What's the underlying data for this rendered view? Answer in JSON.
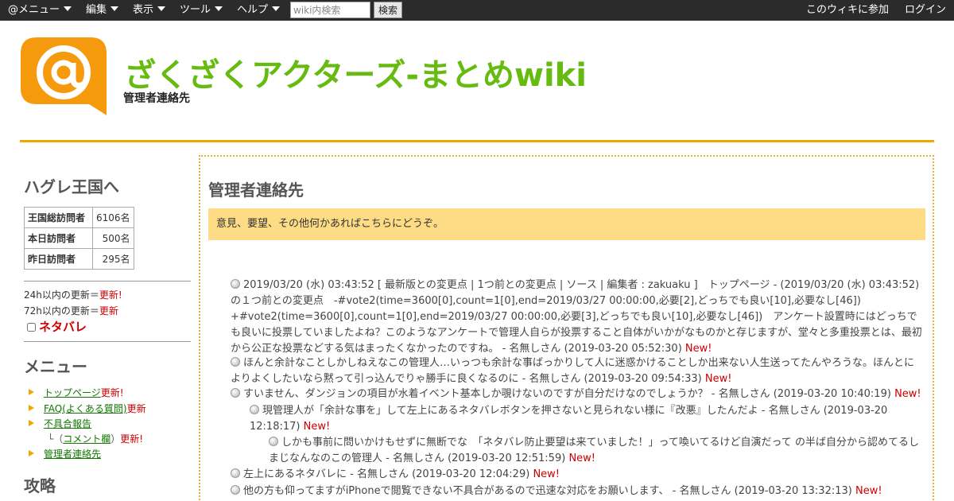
{
  "topbar": {
    "menu": "@メニュー",
    "edit": "編集",
    "view": "表示",
    "tools": "ツール",
    "help": "ヘルプ",
    "search_placeholder": "wiki内検索",
    "search_button": "検索",
    "join": "このウィキに参加",
    "login": "ログイン"
  },
  "header": {
    "title": "ざくざくアクターズ-まとめwiki",
    "subtitle": "管理者連絡先",
    "title_color": "#66bb11",
    "rule_color": "#f0a800"
  },
  "sidebar": {
    "heading1": "ハグレ王国へ",
    "visitors": [
      {
        "label": "王国総訪問者",
        "value": "6106名"
      },
      {
        "label": "本日訪問者",
        "value": "500名"
      },
      {
        "label": "昨日訪問者",
        "value": "295名"
      }
    ],
    "updates_24h_label": "24h以内の更新＝",
    "updates_24h_link": "更新!",
    "updates_72h_label": "72h以内の更新＝",
    "updates_72h_link": "更新",
    "spoiler": "ネタバレ",
    "heading2": "メニュー",
    "menu": [
      {
        "label": "トップページ",
        "new": "更新!"
      },
      {
        "label": "FAQ(よくある質問)",
        "new": "更新"
      },
      {
        "label": "不具合報告",
        "new": ""
      },
      {
        "label": "管理者連絡先",
        "new": ""
      }
    ],
    "sub_prefix": "└（",
    "sub_link": "コメント欄",
    "sub_suffix": "）",
    "sub_new": "更新!",
    "heading3": "攻略"
  },
  "main": {
    "title": "管理者連絡先",
    "notice": "意見、要望、その他何かあればこちらにどうぞ。",
    "comments": [
      {
        "text": "2019/03/20 (水) 03:43:52 [ 最新版との変更点 | 1つ前との変更点 | ソース | 編集者 : zakuaku ]　トップページ - (2019/03/20 (水) 03:43:52) の１つ前との変更点　-#vote2(time=3600[0],count=1[0],end=2019/03/27 00:00:00,必要[2],どっちでも良い[10],必要なし[46]) +#vote2(time=3600[0],count=1[0],end=2019/03/27 00:00:00,必要[3],どっちでも良い[10],必要なし[46])　アンケート設置時にはどっちでも良いに投票していましたよね？このようなアンケートで管理人自らが投票すること自体がいかがなものかと存じますが、堂々と多重投票とは、最初から公正な投票などする気はまったくなかったのですね。 - 名無しさん (2019-03-20 05:52:30)",
        "new": "New!"
      },
      {
        "text": "ほんと余計なことしかしねえなこの管理人…いっつも余計な事ばっかりして人に迷惑かけることしか出来ない人生送ってたんやろうな。ほんとによりよくしたいなら黙って引っ込んでりゃ勝手に良くなるのに - 名無しさん (2019-03-20 09:54:33)",
        "new": "New!"
      },
      {
        "text": "すいません、ダンジョンの項目が水着イベント基本しか覗けないのですが自分だけなのでしょうか？ - 名無しさん (2019-03-20 10:40:19)",
        "new": "New!"
      },
      {
        "text": "現管理人が「余計な事を」して左上にあるネタバレボタンを押さないと見られない様に『改悪』したんだよ - 名無しさん (2019-03-20 12:18:17)",
        "new": "New!"
      },
      {
        "text": "しかも事前に問いかけもせずに無断でな　「ネタバレ防止要望は来ていました！」って喚いてるけど自演だって の半ば自分から認めてるしまじなんなのこの管理人 - 名無しさん (2019-03-20 12:51:59)",
        "new": "New!"
      },
      {
        "text": "左上にあるネタバレに - 名無しさん (2019-03-20 12:04:29)",
        "new": "New!"
      },
      {
        "text": "他の方も仰ってますがiPhoneで閲覧できない不具合があるので迅速な対応をお願いします、 - 名無しさん (2019-03-20 13:32:13)",
        "new": "New!"
      }
    ]
  }
}
